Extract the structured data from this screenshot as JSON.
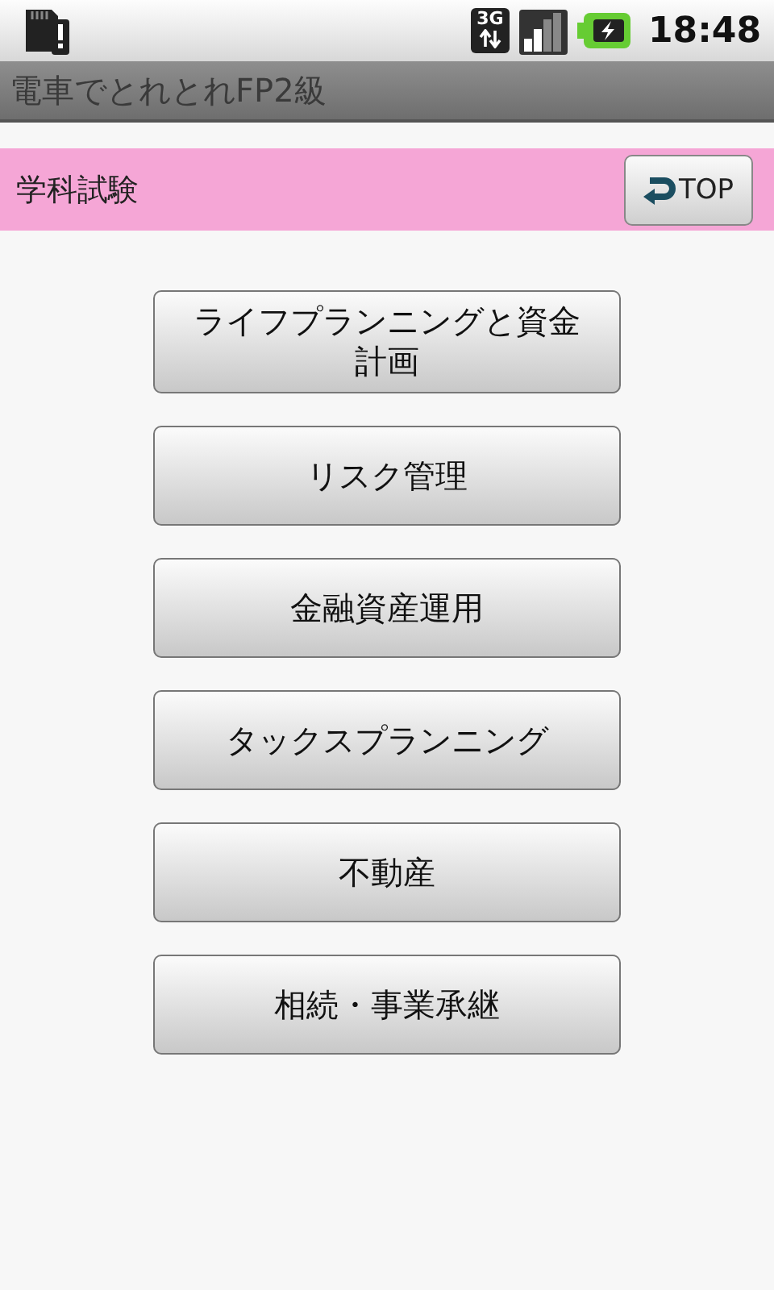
{
  "status_bar": {
    "network": "3G",
    "time": "18:48"
  },
  "title_bar": {
    "title": "電車でとれとれFP2級"
  },
  "header": {
    "title": "学科試験",
    "top_button": "TOP"
  },
  "menu": [
    {
      "label": "ライフプランニングと資金計画"
    },
    {
      "label": "リスク管理"
    },
    {
      "label": "金融資産運用"
    },
    {
      "label": "タックスプランニング"
    },
    {
      "label": "不動産"
    },
    {
      "label": "相続・事業承継"
    }
  ]
}
